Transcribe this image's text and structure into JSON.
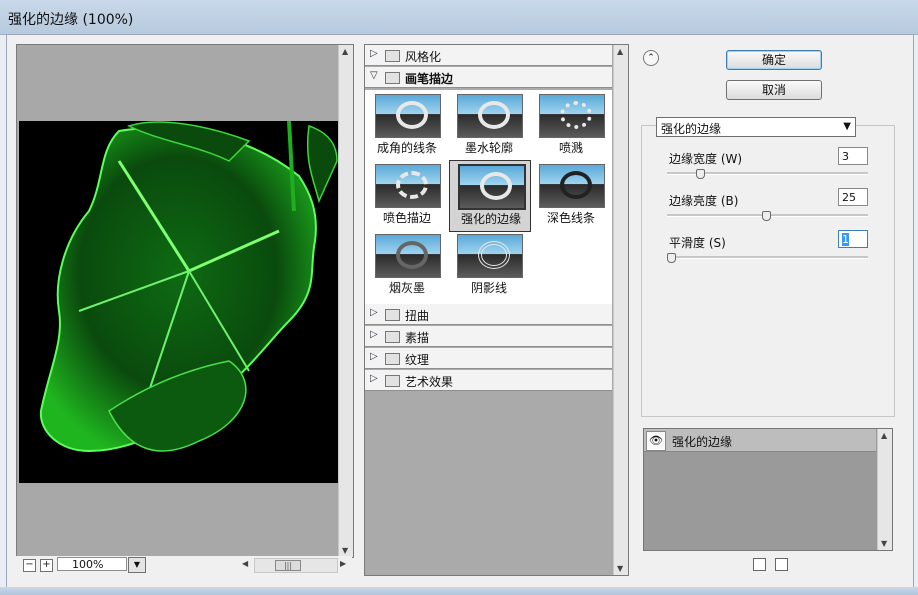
{
  "window": {
    "title": "强化的边缘 (100%)"
  },
  "preview": {
    "zoom": "100%",
    "zoom_minus": "−",
    "zoom_plus": "+"
  },
  "gallery": {
    "categories_top": [
      {
        "label": "风格化",
        "open": false
      }
    ],
    "open_category": {
      "label": "画笔描边"
    },
    "thumbnails": [
      {
        "label": "成角的线条",
        "selected": false
      },
      {
        "label": "墨水轮廓",
        "selected": false
      },
      {
        "label": "喷溅",
        "selected": false
      },
      {
        "label": "喷色描边",
        "selected": false
      },
      {
        "label": "强化的边缘",
        "selected": true
      },
      {
        "label": "深色线条",
        "selected": false
      },
      {
        "label": "烟灰墨",
        "selected": false
      },
      {
        "label": "阴影线",
        "selected": false
      }
    ],
    "categories_bottom": [
      {
        "label": "扭曲"
      },
      {
        "label": "素描"
      },
      {
        "label": "纹理"
      },
      {
        "label": "艺术效果"
      }
    ]
  },
  "actions": {
    "ok": "确定",
    "cancel": "取消"
  },
  "settings": {
    "filter": "强化的边缘",
    "params": [
      {
        "label": "边缘宽度 (W)",
        "value": "3",
        "level": 0.15
      },
      {
        "label": "边缘亮度 (B)",
        "value": "25",
        "level": 0.49
      },
      {
        "label": "平滑度 (S)",
        "value": "1",
        "level": 0.0
      }
    ]
  },
  "layers": {
    "items": [
      {
        "name": "强化的边缘"
      }
    ]
  },
  "colors": {
    "accent": "#3c7fb1",
    "preview_bg": "#a8a8a8",
    "leaf": "#22c422"
  }
}
